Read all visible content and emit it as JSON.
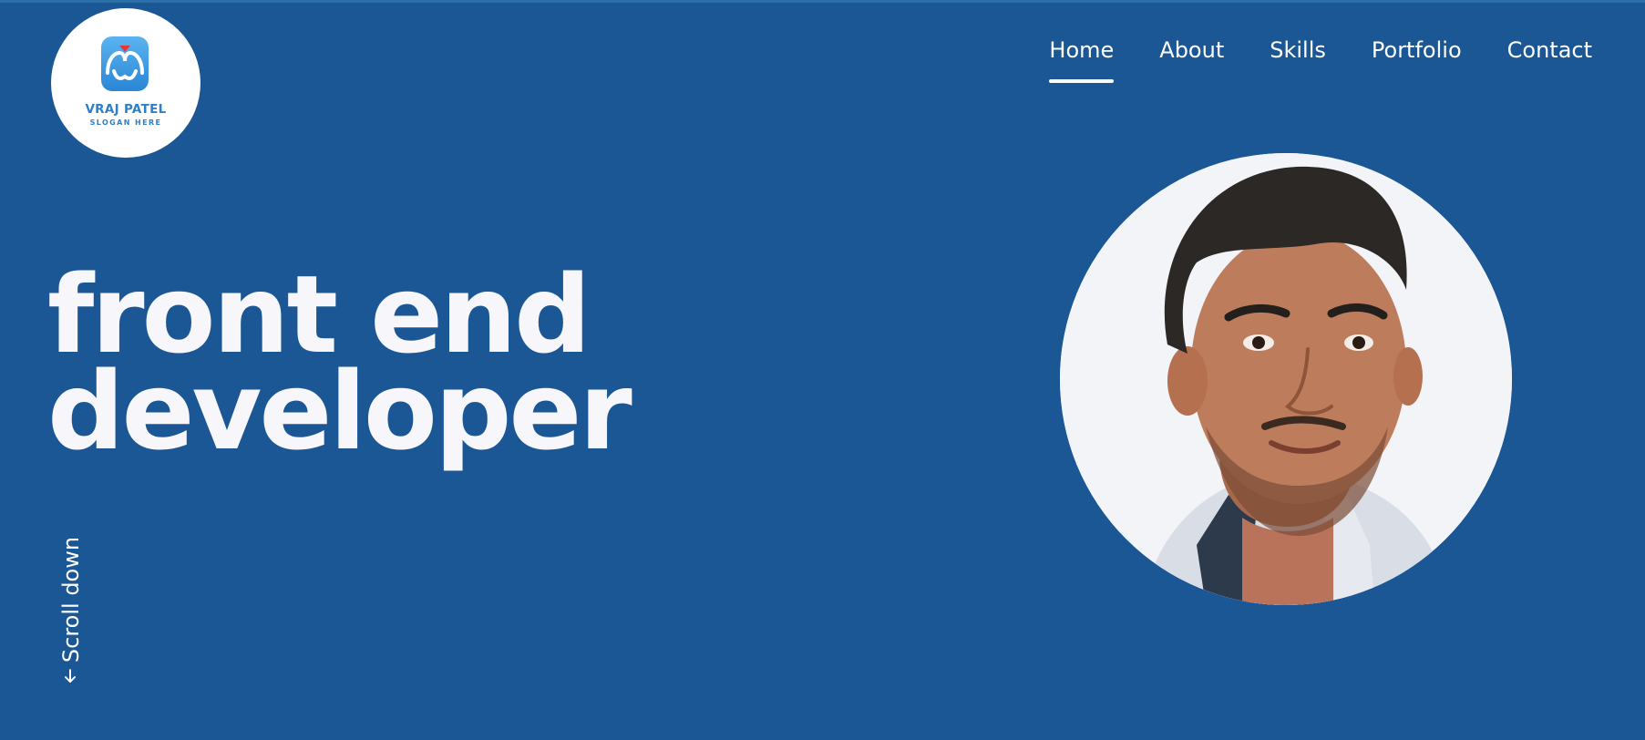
{
  "logo": {
    "name": "VRAJ PATEL",
    "slogan": "SLOGAN HERE",
    "icon": "logo-mark-icon"
  },
  "nav": {
    "items": [
      {
        "label": "Home",
        "active": true
      },
      {
        "label": "About",
        "active": false
      },
      {
        "label": "Skills",
        "active": false
      },
      {
        "label": "Portfolio",
        "active": false
      },
      {
        "label": "Contact",
        "active": false
      }
    ]
  },
  "hero": {
    "headline_line1": "front end",
    "headline_line2": "developer",
    "scroll_label": "Scroll down",
    "scroll_icon": "arrow-down-icon"
  },
  "colors": {
    "background": "#1a5794",
    "text": "#f7f6fb",
    "logo_accent": "#2c7fca"
  }
}
